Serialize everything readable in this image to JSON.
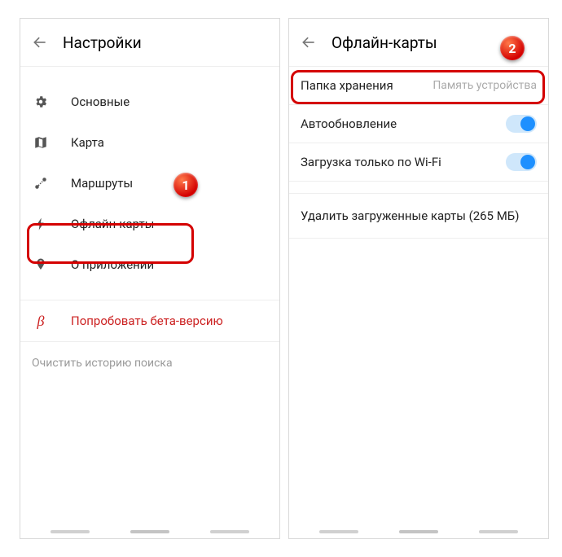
{
  "left": {
    "title": "Настройки",
    "items": [
      {
        "icon": "gear-icon",
        "label": "Основные"
      },
      {
        "icon": "map-icon",
        "label": "Карта"
      },
      {
        "icon": "route-icon",
        "label": "Маршруты"
      },
      {
        "icon": "bolt-icon",
        "label": "Офлайн-карты"
      },
      {
        "icon": "pin-icon",
        "label": "О приложении"
      }
    ],
    "beta": {
      "icon": "beta-icon",
      "label": "Попробовать бета-версию"
    },
    "clear_history": "Очистить историю поиска"
  },
  "right": {
    "title": "Офлайн-карты",
    "storage": {
      "label": "Папка хранения",
      "value": "Память устройства"
    },
    "autoupdate": "Автообновление",
    "wifi_only": "Загрузка только по Wi-Fi",
    "delete_maps": "Удалить загруженные карты (265 МБ)"
  },
  "callouts": {
    "one": "1",
    "two": "2"
  }
}
